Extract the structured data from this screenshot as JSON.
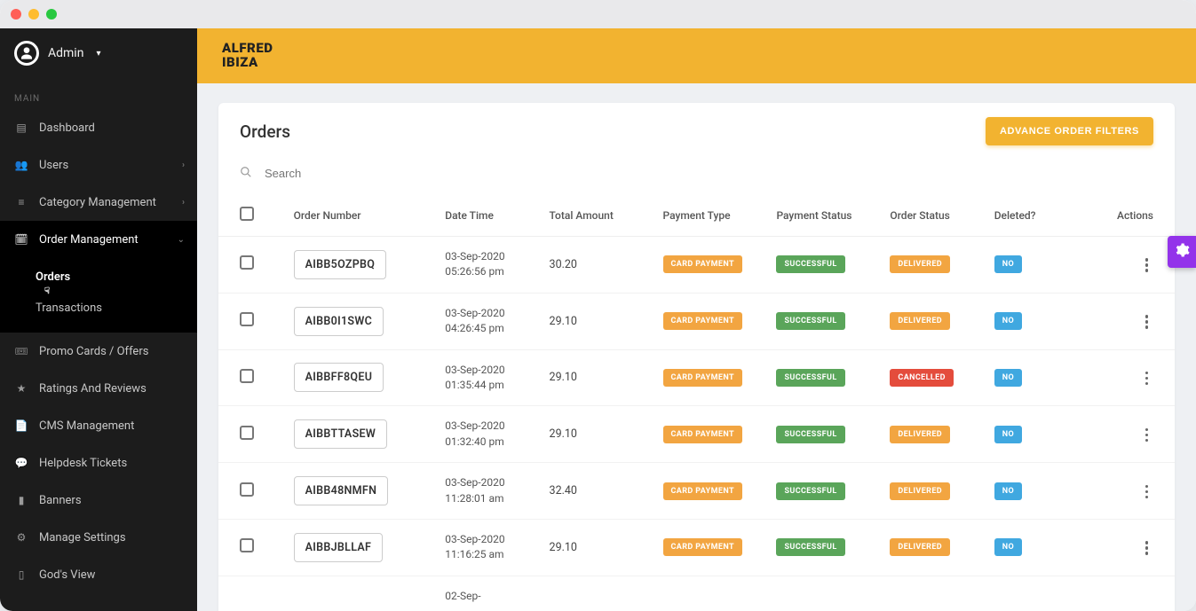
{
  "user": {
    "name": "Admin"
  },
  "brand": {
    "line1": "ALFRED",
    "line2": "IBIZA"
  },
  "sidebar": {
    "section_label": "MAIN",
    "items": [
      {
        "icon": "dashboard",
        "label": "Dashboard",
        "chev": false,
        "active": false
      },
      {
        "icon": "users",
        "label": "Users",
        "chev": true,
        "active": false
      },
      {
        "icon": "category",
        "label": "Category Management",
        "chev": true,
        "active": false
      },
      {
        "icon": "order",
        "label": "Order Management",
        "chev": true,
        "active": true,
        "expanded": true,
        "subs": [
          {
            "label": "Orders",
            "current": true,
            "cursor": true
          },
          {
            "label": "Transactions",
            "current": false
          }
        ]
      },
      {
        "icon": "promo",
        "label": "Promo Cards / Offers",
        "chev": false
      },
      {
        "icon": "star",
        "label": "Ratings And Reviews",
        "chev": false
      },
      {
        "icon": "cms",
        "label": "CMS Management",
        "chev": false
      },
      {
        "icon": "chat",
        "label": "Helpdesk Tickets",
        "chev": false
      },
      {
        "icon": "banner",
        "label": "Banners",
        "chev": false
      },
      {
        "icon": "gear",
        "label": "Manage Settings",
        "chev": false
      },
      {
        "icon": "eye",
        "label": "God's View",
        "chev": false
      }
    ]
  },
  "page": {
    "title": "Orders",
    "filters_button": "ADVANCE ORDER FILTERS",
    "search_placeholder": "Search"
  },
  "table": {
    "headers": {
      "order_number": "Order Number",
      "date_time": "Date Time",
      "total_amount": "Total Amount",
      "payment_type": "Payment Type",
      "payment_status": "Payment Status",
      "order_status": "Order Status",
      "deleted": "Deleted?",
      "actions": "Actions"
    },
    "rows": [
      {
        "order_number": "AIBB5OZPBQ",
        "date_time": "03-Sep-2020 05:26:56 pm",
        "total_amount": "30.20",
        "payment_type": "CARD PAYMENT",
        "payment_status": "SUCCESSFUL",
        "order_status": "DELIVERED",
        "order_status_color": "orange",
        "deleted": "NO"
      },
      {
        "order_number": "AIBB0I1SWC",
        "date_time": "03-Sep-2020 04:26:45 pm",
        "total_amount": "29.10",
        "payment_type": "CARD PAYMENT",
        "payment_status": "SUCCESSFUL",
        "order_status": "DELIVERED",
        "order_status_color": "orange",
        "deleted": "NO"
      },
      {
        "order_number": "AIBBFF8QEU",
        "date_time": "03-Sep-2020 01:35:44 pm",
        "total_amount": "29.10",
        "payment_type": "CARD PAYMENT",
        "payment_status": "SUCCESSFUL",
        "order_status": "CANCELLED",
        "order_status_color": "red",
        "deleted": "NO"
      },
      {
        "order_number": "AIBBTTASEW",
        "date_time": "03-Sep-2020 01:32:40 pm",
        "total_amount": "29.10",
        "payment_type": "CARD PAYMENT",
        "payment_status": "SUCCESSFUL",
        "order_status": "DELIVERED",
        "order_status_color": "orange",
        "deleted": "NO"
      },
      {
        "order_number": "AIBB48NMFN",
        "date_time": "03-Sep-2020 11:28:01 am",
        "total_amount": "32.40",
        "payment_type": "CARD PAYMENT",
        "payment_status": "SUCCESSFUL",
        "order_status": "DELIVERED",
        "order_status_color": "orange",
        "deleted": "NO"
      },
      {
        "order_number": "AIBBJBLLAF",
        "date_time": "03-Sep-2020 11:16:25 am",
        "total_amount": "29.10",
        "payment_type": "CARD PAYMENT",
        "payment_status": "SUCCESSFUL",
        "order_status": "DELIVERED",
        "order_status_color": "orange",
        "deleted": "NO"
      },
      {
        "order_number": "",
        "date_time": "02-Sep-",
        "total_amount": "",
        "payment_type": "",
        "payment_status": "",
        "order_status": "",
        "order_status_color": "",
        "deleted": ""
      }
    ]
  },
  "colors": {
    "accent": "#f2b330",
    "sidebar_bg": "#1c1c1c",
    "badge_orange": "#f2a541",
    "badge_green": "#5aa55a",
    "badge_red": "#e44c3c",
    "badge_blue": "#40a8e0",
    "fab_purple": "#9333ea"
  },
  "icon_glyphs": {
    "dashboard": "▤",
    "users": "👥",
    "category": "≡",
    "order": "🗓",
    "promo": "🎟",
    "star": "★",
    "cms": "📄",
    "chat": "💬",
    "banner": "▮",
    "gear": "⚙",
    "eye": "▯"
  }
}
